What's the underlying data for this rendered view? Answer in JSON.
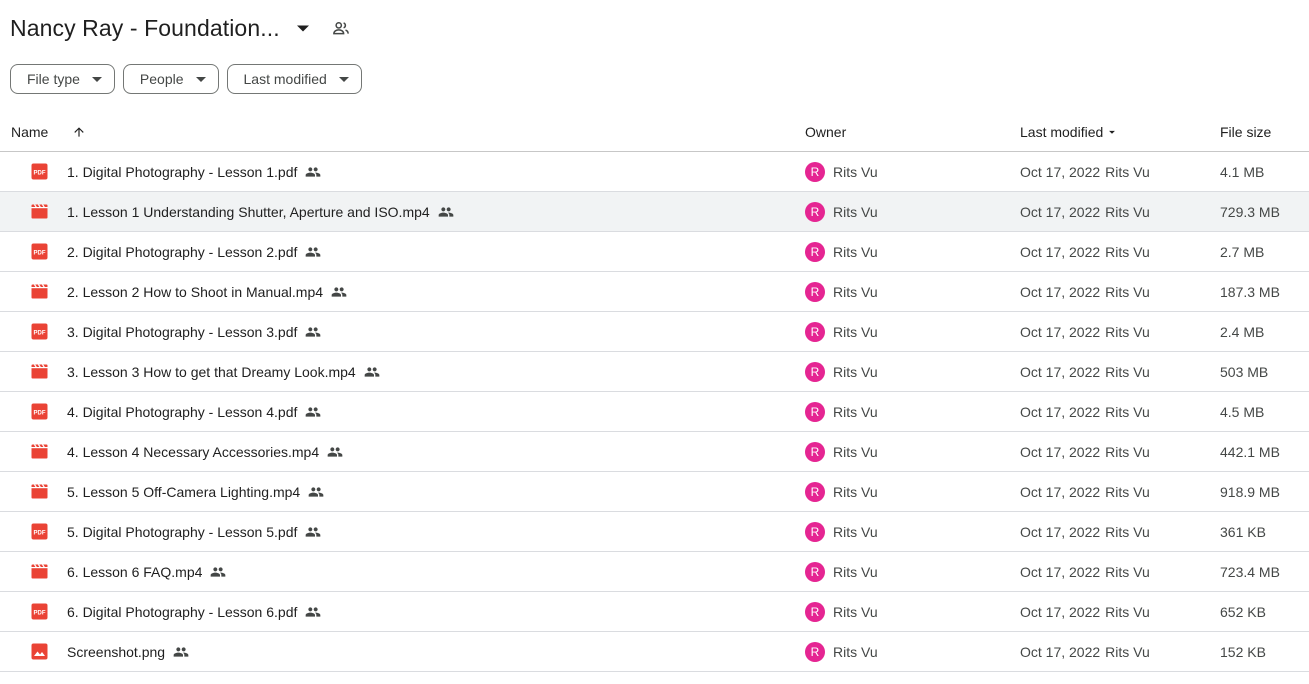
{
  "title": "Nancy Ray - Foundation...",
  "filters": [
    {
      "label": "File type"
    },
    {
      "label": "People"
    },
    {
      "label": "Last modified"
    }
  ],
  "columns": {
    "name": "Name",
    "owner": "Owner",
    "last_modified": "Last modified",
    "file_size": "File size"
  },
  "colors": {
    "pdf": "#ea4335",
    "avatar": "#e52592"
  },
  "files": [
    {
      "name": "1. Digital Photography - Lesson 1.pdf",
      "type": "pdf",
      "owner": "Rits Vu",
      "owner_initial": "R",
      "modified": "Oct 17, 2022",
      "modified_by": "Rits Vu",
      "size": "4.1 MB"
    },
    {
      "name": "1. Lesson 1 Understanding Shutter, Aperture and ISO.mp4",
      "type": "video",
      "owner": "Rits Vu",
      "owner_initial": "R",
      "modified": "Oct 17, 2022",
      "modified_by": "Rits Vu",
      "size": "729.3 MB",
      "selected": true
    },
    {
      "name": "2. Digital Photography - Lesson 2.pdf",
      "type": "pdf",
      "owner": "Rits Vu",
      "owner_initial": "R",
      "modified": "Oct 17, 2022",
      "modified_by": "Rits Vu",
      "size": "2.7 MB"
    },
    {
      "name": "2. Lesson 2 How to Shoot in Manual.mp4",
      "type": "video",
      "owner": "Rits Vu",
      "owner_initial": "R",
      "modified": "Oct 17, 2022",
      "modified_by": "Rits Vu",
      "size": "187.3 MB"
    },
    {
      "name": "3. Digital Photography - Lesson 3.pdf",
      "type": "pdf",
      "owner": "Rits Vu",
      "owner_initial": "R",
      "modified": "Oct 17, 2022",
      "modified_by": "Rits Vu",
      "size": "2.4 MB"
    },
    {
      "name": "3. Lesson 3 How to get that Dreamy Look.mp4",
      "type": "video",
      "owner": "Rits Vu",
      "owner_initial": "R",
      "modified": "Oct 17, 2022",
      "modified_by": "Rits Vu",
      "size": "503 MB"
    },
    {
      "name": "4. Digital Photography - Lesson 4.pdf",
      "type": "pdf",
      "owner": "Rits Vu",
      "owner_initial": "R",
      "modified": "Oct 17, 2022",
      "modified_by": "Rits Vu",
      "size": "4.5 MB"
    },
    {
      "name": "4. Lesson 4 Necessary Accessories.mp4",
      "type": "video",
      "owner": "Rits Vu",
      "owner_initial": "R",
      "modified": "Oct 17, 2022",
      "modified_by": "Rits Vu",
      "size": "442.1 MB"
    },
    {
      "name": "5.  Lesson 5 Off-Camera Lighting.mp4",
      "type": "video",
      "owner": "Rits Vu",
      "owner_initial": "R",
      "modified": "Oct 17, 2022",
      "modified_by": "Rits Vu",
      "size": "918.9 MB"
    },
    {
      "name": "5. Digital Photography - Lesson 5.pdf",
      "type": "pdf",
      "owner": "Rits Vu",
      "owner_initial": "R",
      "modified": "Oct 17, 2022",
      "modified_by": "Rits Vu",
      "size": "361 KB"
    },
    {
      "name": "6.  Lesson 6 FAQ.mp4",
      "type": "video",
      "owner": "Rits Vu",
      "owner_initial": "R",
      "modified": "Oct 17, 2022",
      "modified_by": "Rits Vu",
      "size": "723.4 MB"
    },
    {
      "name": "6. Digital Photography - Lesson 6.pdf",
      "type": "pdf",
      "owner": "Rits Vu",
      "owner_initial": "R",
      "modified": "Oct 17, 2022",
      "modified_by": "Rits Vu",
      "size": "652 KB"
    },
    {
      "name": "Screenshot.png",
      "type": "image",
      "owner": "Rits Vu",
      "owner_initial": "R",
      "modified": "Oct 17, 2022",
      "modified_by": "Rits Vu",
      "size": "152 KB"
    }
  ]
}
